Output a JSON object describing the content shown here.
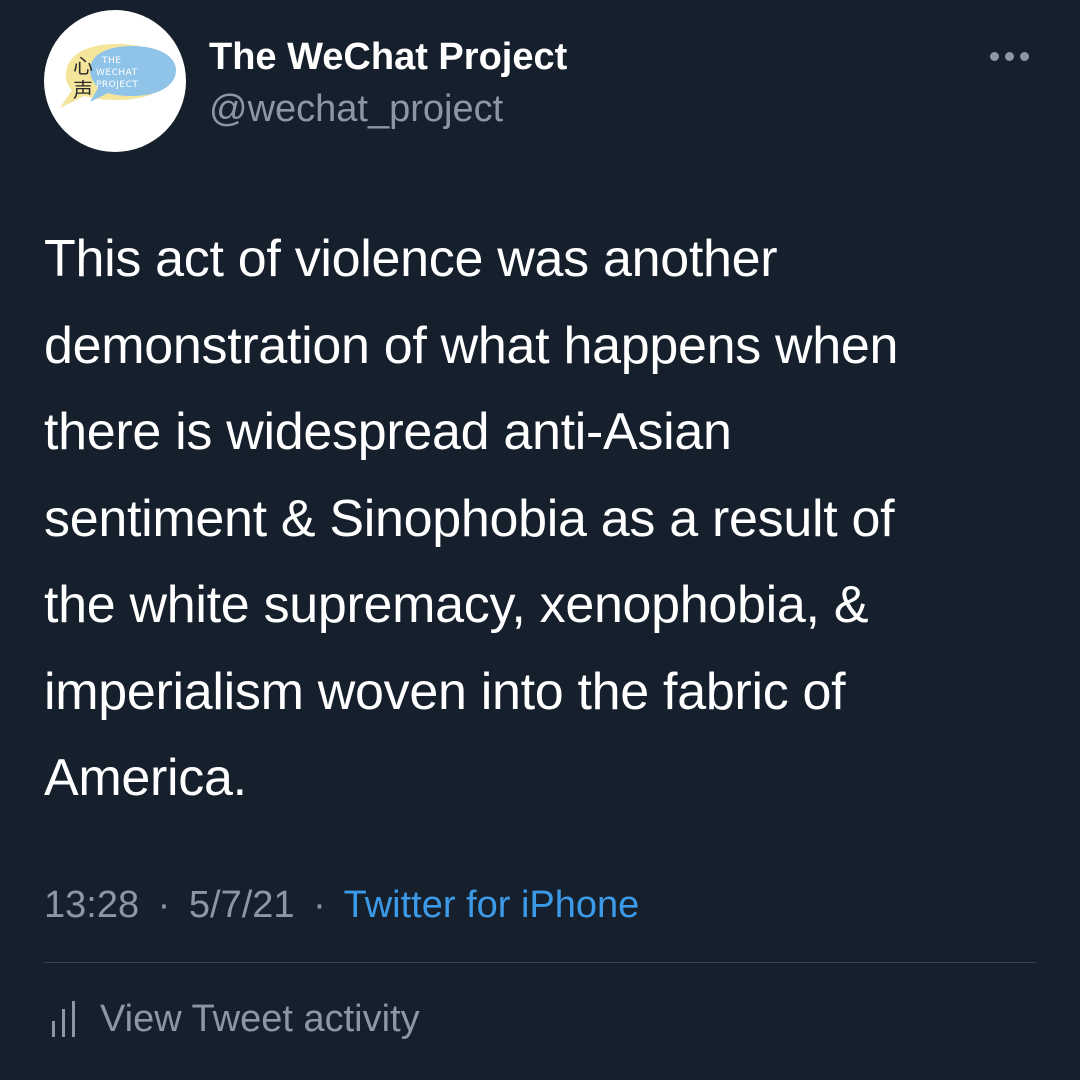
{
  "account": {
    "display_name": "The WeChat Project",
    "handle": "@wechat_project",
    "avatar_logo": {
      "chinese_chars": "心声",
      "english_lines": [
        "THE",
        "WECHAT",
        "PROJECT"
      ]
    }
  },
  "tweet": {
    "text": "This act of violence was another\ndemonstration of what happens when\nthere is widespread anti-Asian\nsentiment & Sinophobia as a result of\nthe white supremacy, xenophobia, &\nimperialism woven into the fabric of\nAmerica.",
    "time": "13:28",
    "separator": "·",
    "date": "5/7/21",
    "source": "Twitter for iPhone"
  },
  "actions": {
    "more_icon": "more-horizontal-icon",
    "activity_icon": "bar-chart-icon",
    "activity_label": "View Tweet activity"
  },
  "colors": {
    "background": "#16202c",
    "primary_text": "#ffffff",
    "secondary_text": "#8a98a6",
    "link": "#3c9be8",
    "divider": "#38444f"
  }
}
